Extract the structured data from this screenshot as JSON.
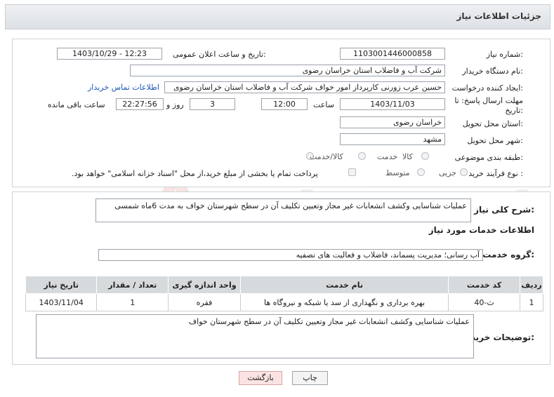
{
  "header": {
    "title": "جزئیات اطلاعات نیاز"
  },
  "form": {
    "need_number_label": "شماره نیاز:",
    "need_number": "1103001446000858",
    "announce_label": "تاریخ و ساعت اعلان عمومی:",
    "announce_value": "1403/10/29 - 12:23",
    "buyer_label": "نام دستگاه خریدار:",
    "buyer_value": "شرکت آب و فاضلاب استان خراسان رضوی",
    "creator_label": "ایجاد کننده درخواست:",
    "creator_value": "حسین عرب زورنی کارپرداز امور خواف  شرکت آب و فاضلاب استان خراسان رضوی",
    "contact_link": "اطلاعات تماس خریدار",
    "deadline_label_1": "مهلت ارسال پاسخ: تا",
    "deadline_label_2": "تاریخ:",
    "deadline_date": "1403/11/03",
    "time_label": "ساعت",
    "deadline_time": "12:00",
    "days_value": "3",
    "days_label": "روز و",
    "remaining_time": "22:27:56",
    "remaining_label": "ساعت باقی مانده",
    "province_label": "استان محل تحویل:",
    "province_value": "خراسان رضوی",
    "city_label": "شهر محل تحویل:",
    "city_value": "مشهد",
    "category_label": "طبقه بندی موضوعی:",
    "category_options": [
      "کالا",
      "خدمت",
      "کالا/خدمت"
    ],
    "process_label": "نوع فرآیند خرید :",
    "process_options": [
      "جزیی",
      "متوسط"
    ],
    "payment_note": "پرداخت تمام یا بخشی از مبلغ خرید،از محل \"اسناد خزانه اسلامی\" خواهد بود."
  },
  "summary": {
    "label": "شرح کلی نیاز:",
    "text": "عملیات شناسایی وکشف انشعابات غیر مجاز وتعیین تکلیف آن در سطح شهرستان خواف به مدت 6ماه شمسی"
  },
  "services": {
    "section_title": "اطلاعات خدمات مورد نیاز",
    "group_label": "گروه خدمت:",
    "group_value": "آب رسانی؛ مدیریت پسماند، فاضلاب و فعالیت های تصفیه",
    "columns": [
      "ردیف",
      "کد خدمت",
      "نام خدمت",
      "واحد اندازه گیری",
      "تعداد / مقدار",
      "تاریخ نیاز"
    ],
    "rows": [
      {
        "idx": "1",
        "code": "ث-40",
        "name": "بهره برداری و نگهداری از سد یا شبکه و نیروگاه ها",
        "unit": "فقره",
        "qty": "1",
        "date": "1403/11/04"
      }
    ]
  },
  "buyer_notes": {
    "label": "توضیحات خریدار:",
    "text": "عملیات شناسایی وکشف انشعابات غیر مجاز وتعیین تکلیف آن در سطح شهرستان خواف"
  },
  "buttons": {
    "print": "چاپ",
    "back": "بازگشت"
  },
  "watermark": "AriaTender.neT"
}
